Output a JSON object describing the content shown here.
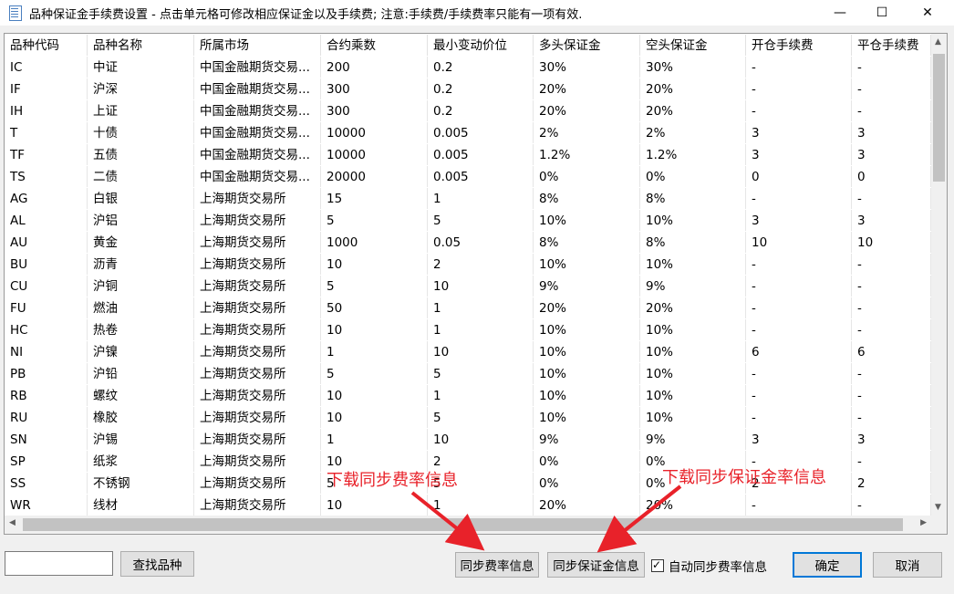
{
  "window": {
    "title": "品种保证金手续费设置  -  点击单元格可修改相应保证金以及手续费; 注意:手续费/手续费率只能有一项有效.",
    "min_glyph": "—",
    "max_glyph": "☐",
    "close_glyph": "✕"
  },
  "table": {
    "headers": [
      "品种代码",
      "品种名称",
      "所属市场",
      "合约乘数",
      "最小变动价位",
      "多头保证金",
      "空头保证金",
      "开仓手续费",
      "平仓手续费"
    ],
    "rows": [
      [
        "IC",
        "中证",
        "中国金融期货交易...",
        "200",
        "0.2",
        "30%",
        "30%",
        "-",
        "-"
      ],
      [
        "IF",
        "沪深",
        "中国金融期货交易...",
        "300",
        "0.2",
        "20%",
        "20%",
        "-",
        "-"
      ],
      [
        "IH",
        "上证",
        "中国金融期货交易...",
        "300",
        "0.2",
        "20%",
        "20%",
        "-",
        "-"
      ],
      [
        "T",
        "十债",
        "中国金融期货交易...",
        "10000",
        "0.005",
        "2%",
        "2%",
        "3",
        "3"
      ],
      [
        "TF",
        "五债",
        "中国金融期货交易...",
        "10000",
        "0.005",
        "1.2%",
        "1.2%",
        "3",
        "3"
      ],
      [
        "TS",
        "二债",
        "中国金融期货交易...",
        "20000",
        "0.005",
        "0%",
        "0%",
        "0",
        "0"
      ],
      [
        "AG",
        "白银",
        "上海期货交易所",
        "15",
        "1",
        "8%",
        "8%",
        "-",
        "-"
      ],
      [
        "AL",
        "沪铝",
        "上海期货交易所",
        "5",
        "5",
        "10%",
        "10%",
        "3",
        "3"
      ],
      [
        "AU",
        "黄金",
        "上海期货交易所",
        "1000",
        "0.05",
        "8%",
        "8%",
        "10",
        "10"
      ],
      [
        "BU",
        "沥青",
        "上海期货交易所",
        "10",
        "2",
        "10%",
        "10%",
        "-",
        "-"
      ],
      [
        "CU",
        "沪铜",
        "上海期货交易所",
        "5",
        "10",
        "9%",
        "9%",
        "-",
        "-"
      ],
      [
        "FU",
        "燃油",
        "上海期货交易所",
        "50",
        "1",
        "20%",
        "20%",
        "-",
        "-"
      ],
      [
        "HC",
        "热卷",
        "上海期货交易所",
        "10",
        "1",
        "10%",
        "10%",
        "-",
        "-"
      ],
      [
        "NI",
        "沪镍",
        "上海期货交易所",
        "1",
        "10",
        "10%",
        "10%",
        "6",
        "6"
      ],
      [
        "PB",
        "沪铅",
        "上海期货交易所",
        "5",
        "5",
        "10%",
        "10%",
        "-",
        "-"
      ],
      [
        "RB",
        "螺纹",
        "上海期货交易所",
        "10",
        "1",
        "10%",
        "10%",
        "-",
        "-"
      ],
      [
        "RU",
        "橡胶",
        "上海期货交易所",
        "10",
        "5",
        "10%",
        "10%",
        "-",
        "-"
      ],
      [
        "SN",
        "沪锡",
        "上海期货交易所",
        "1",
        "10",
        "9%",
        "9%",
        "3",
        "3"
      ],
      [
        "SP",
        "纸浆",
        "上海期货交易所",
        "10",
        "2",
        "0%",
        "0%",
        "-",
        "-"
      ],
      [
        "SS",
        "不锈钢",
        "上海期货交易所",
        "5",
        "5",
        "0%",
        "0%",
        "2",
        "2"
      ],
      [
        "WR",
        "线材",
        "上海期货交易所",
        "10",
        "1",
        "20%",
        "20%",
        "-",
        "-"
      ]
    ]
  },
  "footer": {
    "search_value": "",
    "find_button": "查找品种",
    "sync_fee_button": "同步费率信息",
    "sync_margin_button": "同步保证金信息",
    "auto_sync_label": "自动同步费率信息",
    "auto_sync_checked": true,
    "ok_button": "确定",
    "cancel_button": "取消"
  },
  "annotations": {
    "fee_note": "下载同步费率信息",
    "margin_note": "下载同步保证金率信息",
    "color": "#e8222a"
  }
}
